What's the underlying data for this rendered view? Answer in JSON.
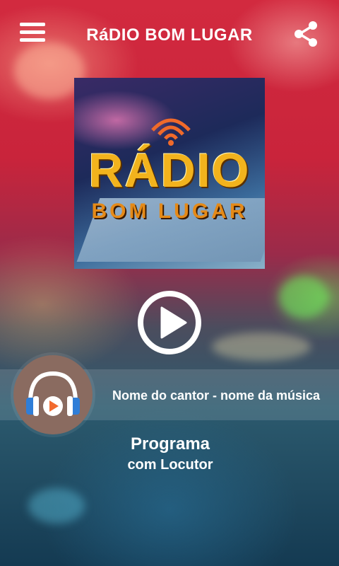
{
  "app": {
    "title": "RáDIO BOM LUGAR",
    "menu_icon": "hamburger-menu-icon",
    "share_icon": "share-icon"
  },
  "cover": {
    "line1": "RÁDIO",
    "line2": "BOM LUGAR",
    "icon": "radio-waves-icon"
  },
  "player": {
    "play_icon": "play-circle-icon",
    "track": "Nome do cantor - nome da música",
    "avatar_icon": "headphones-play-icon",
    "program_title": "Programa",
    "program_host": "com Locutor"
  },
  "colors": {
    "primary_red": "#d22a3f",
    "avatar_bg": "#8a6b60",
    "headphone_blue": "#2f7ed8",
    "play_orange": "#f26a2e"
  }
}
